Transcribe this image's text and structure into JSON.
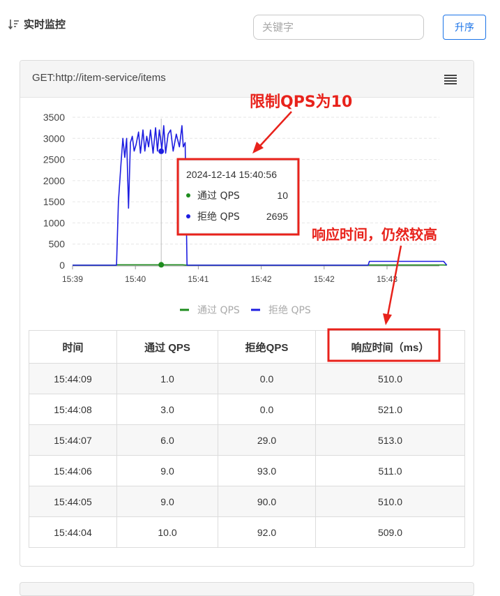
{
  "header": {
    "title": "实时监控",
    "search_placeholder": "关键字",
    "sort_button": "升序"
  },
  "panel": {
    "title": "GET:http://item-service/items"
  },
  "chart_data": {
    "type": "line",
    "x": [
      "15:39",
      "15:40",
      "15:41",
      "15:42",
      "15:42",
      "15:43"
    ],
    "ylim": [
      0,
      3500
    ],
    "yticks": [
      0,
      500,
      1000,
      1500,
      2000,
      2500,
      3000,
      3500
    ],
    "grid": true,
    "legend_position": "bottom",
    "series": [
      {
        "name": "通过 QPS",
        "color": "#1e8c1e",
        "points": [
          [
            0,
            0
          ],
          [
            0.68,
            0
          ],
          [
            0.71,
            10
          ],
          [
            1.2,
            10
          ],
          [
            1.35,
            10
          ],
          [
            1.75,
            10
          ],
          [
            1.83,
            0
          ],
          [
            4.7,
            0
          ],
          [
            4.72,
            5
          ],
          [
            5.9,
            5
          ],
          [
            5.95,
            0
          ]
        ]
      },
      {
        "name": "拒绝 QPS",
        "color": "#1d1de0",
        "points": [
          [
            0,
            0
          ],
          [
            0.7,
            0
          ],
          [
            0.73,
            1500
          ],
          [
            0.77,
            2400
          ],
          [
            0.8,
            3000
          ],
          [
            0.83,
            2550
          ],
          [
            0.86,
            3000
          ],
          [
            0.89,
            1350
          ],
          [
            0.92,
            2900
          ],
          [
            0.95,
            3050
          ],
          [
            0.98,
            2700
          ],
          [
            1.01,
            2850
          ],
          [
            1.05,
            3150
          ],
          [
            1.08,
            2650
          ],
          [
            1.12,
            3200
          ],
          [
            1.15,
            2700
          ],
          [
            1.18,
            3050
          ],
          [
            1.21,
            2800
          ],
          [
            1.24,
            3200
          ],
          [
            1.28,
            2650
          ],
          [
            1.32,
            3250
          ],
          [
            1.35,
            2700
          ],
          [
            1.38,
            3200
          ],
          [
            1.42,
            2750
          ],
          [
            1.45,
            3300
          ],
          [
            1.48,
            2650
          ],
          [
            1.52,
            3100
          ],
          [
            1.56,
            3200
          ],
          [
            1.6,
            2700
          ],
          [
            1.65,
            3100
          ],
          [
            1.7,
            2800
          ],
          [
            1.74,
            3300
          ],
          [
            1.76,
            2800
          ],
          [
            1.79,
            2900
          ],
          [
            1.82,
            0
          ],
          [
            4.7,
            0
          ],
          [
            4.72,
            90
          ],
          [
            5.9,
            90
          ],
          [
            5.95,
            0
          ]
        ]
      }
    ],
    "tooltip": {
      "time": "2024-12-14 15:40:56",
      "x": 1.41,
      "rows": [
        {
          "label": "通过 QPS",
          "value": "10",
          "color": "#1e8c1e"
        },
        {
          "label": "拒绝 QPS",
          "value": "2695",
          "color": "#1d1de0"
        }
      ]
    }
  },
  "table": {
    "headers": [
      "时间",
      "通过 QPS",
      "拒绝QPS",
      "响应时间（ms）"
    ],
    "rows": [
      [
        "15:44:09",
        "1.0",
        "0.0",
        "510.0"
      ],
      [
        "15:44:08",
        "3.0",
        "0.0",
        "521.0"
      ],
      [
        "15:44:07",
        "6.0",
        "29.0",
        "513.0"
      ],
      [
        "15:44:06",
        "9.0",
        "93.0",
        "511.0"
      ],
      [
        "15:44:05",
        "9.0",
        "90.0",
        "510.0"
      ],
      [
        "15:44:04",
        "10.0",
        "92.0",
        "509.0"
      ]
    ]
  },
  "annotations": {
    "qps_limit": "限制QPS为10",
    "response_note": "响应时间，仍然较高",
    "accent_color": "#e8221b"
  }
}
